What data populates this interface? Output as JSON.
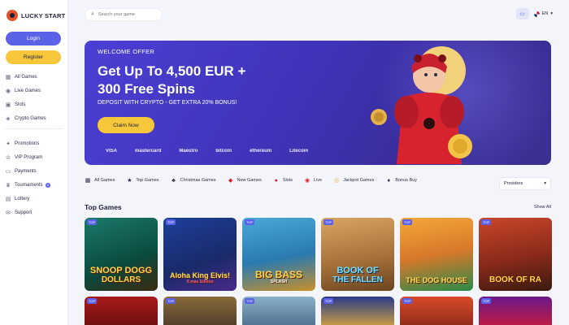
{
  "brand": {
    "name": "LUCKY START"
  },
  "auth": {
    "login_label": "Login",
    "register_label": "Register"
  },
  "sidebar": {
    "primary": [
      {
        "label": "All Games",
        "icon": "grid-icon"
      },
      {
        "label": "Live Games",
        "icon": "live-icon"
      },
      {
        "label": "Slots",
        "icon": "slots-icon"
      },
      {
        "label": "Crypto Games",
        "icon": "crypto-icon"
      }
    ],
    "secondary": [
      {
        "label": "Promotions",
        "icon": "gift-icon"
      },
      {
        "label": "VIP Program",
        "icon": "crown-icon"
      },
      {
        "label": "Payments",
        "icon": "card-icon"
      },
      {
        "label": "Tournaments",
        "icon": "trophy-icon",
        "badge": "8"
      },
      {
        "label": "Lottery",
        "icon": "ticket-icon"
      },
      {
        "label": "Support",
        "icon": "chat-icon"
      }
    ]
  },
  "topbar": {
    "search_placeholder": "Search your game",
    "language": "EN"
  },
  "banner": {
    "kicker": "WELCOME OFFER",
    "title_line1": "Get Up To 4,500 EUR +",
    "title_line2": "300 Free Spins",
    "subtitle": "DEPOSIT WITH CRYPTO - GET EXTRA 20% BONUS!",
    "cta": "Claim Now",
    "payments": [
      "VISA",
      "mastercard",
      "Maestro",
      "bitcoin",
      "ethereum",
      "Litecoin"
    ]
  },
  "categories": [
    {
      "label": "All Games",
      "icon": "grid-icon"
    },
    {
      "label": "Top Games",
      "icon": "star-icon"
    },
    {
      "label": "Christmas Games",
      "icon": "tree-icon"
    },
    {
      "label": "New Games",
      "icon": "dice-icon"
    },
    {
      "label": "Slots",
      "icon": "cherry-icon"
    },
    {
      "label": "Live",
      "icon": "live-icon"
    },
    {
      "label": "Jackpot Games",
      "icon": "coins-icon"
    },
    {
      "label": "Bonus Buy",
      "icon": "diamond-icon"
    }
  ],
  "providers_label": "Providers",
  "top_games": {
    "title": "Top Games",
    "show_all": "Show All",
    "tag": "TOP",
    "games": [
      {
        "name": "SNOOP DOGG",
        "sub": "DOLLARS"
      },
      {
        "name": "Aloha King Elvis!",
        "sub": "X-mas Edition"
      },
      {
        "name": "BIG BASS",
        "sub": "SPLASH"
      },
      {
        "name": "BOOK OF",
        "sub": "THE FALLEN"
      },
      {
        "name": "THE DOG HOUSE",
        "sub": ""
      },
      {
        "name": "BOOK OF RA",
        "sub": ""
      }
    ]
  },
  "colors": {
    "accent": "#5b62e8",
    "cta": "#f7c73b",
    "banner": "#3f34b8"
  }
}
